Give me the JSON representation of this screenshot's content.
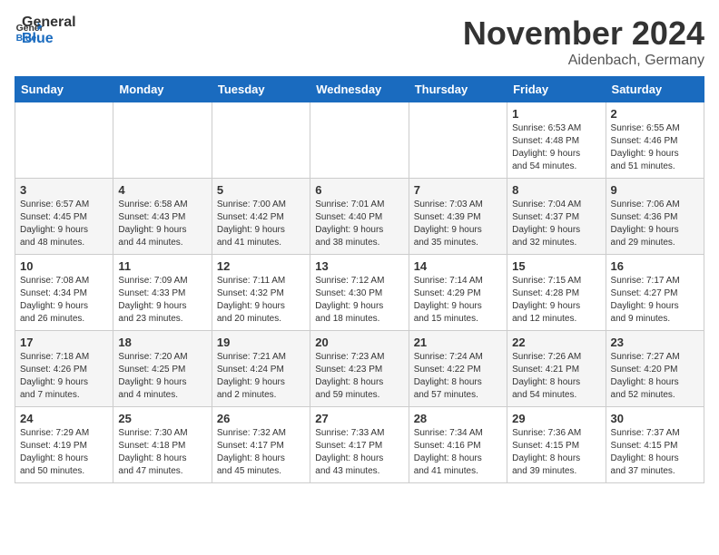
{
  "header": {
    "logo_general": "General",
    "logo_blue": "Blue",
    "month_title": "November 2024",
    "location": "Aidenbach, Germany"
  },
  "days_of_week": [
    "Sunday",
    "Monday",
    "Tuesday",
    "Wednesday",
    "Thursday",
    "Friday",
    "Saturday"
  ],
  "weeks": [
    [
      {
        "day": "",
        "info": ""
      },
      {
        "day": "",
        "info": ""
      },
      {
        "day": "",
        "info": ""
      },
      {
        "day": "",
        "info": ""
      },
      {
        "day": "",
        "info": ""
      },
      {
        "day": "1",
        "info": "Sunrise: 6:53 AM\nSunset: 4:48 PM\nDaylight: 9 hours\nand 54 minutes."
      },
      {
        "day": "2",
        "info": "Sunrise: 6:55 AM\nSunset: 4:46 PM\nDaylight: 9 hours\nand 51 minutes."
      }
    ],
    [
      {
        "day": "3",
        "info": "Sunrise: 6:57 AM\nSunset: 4:45 PM\nDaylight: 9 hours\nand 48 minutes."
      },
      {
        "day": "4",
        "info": "Sunrise: 6:58 AM\nSunset: 4:43 PM\nDaylight: 9 hours\nand 44 minutes."
      },
      {
        "day": "5",
        "info": "Sunrise: 7:00 AM\nSunset: 4:42 PM\nDaylight: 9 hours\nand 41 minutes."
      },
      {
        "day": "6",
        "info": "Sunrise: 7:01 AM\nSunset: 4:40 PM\nDaylight: 9 hours\nand 38 minutes."
      },
      {
        "day": "7",
        "info": "Sunrise: 7:03 AM\nSunset: 4:39 PM\nDaylight: 9 hours\nand 35 minutes."
      },
      {
        "day": "8",
        "info": "Sunrise: 7:04 AM\nSunset: 4:37 PM\nDaylight: 9 hours\nand 32 minutes."
      },
      {
        "day": "9",
        "info": "Sunrise: 7:06 AM\nSunset: 4:36 PM\nDaylight: 9 hours\nand 29 minutes."
      }
    ],
    [
      {
        "day": "10",
        "info": "Sunrise: 7:08 AM\nSunset: 4:34 PM\nDaylight: 9 hours\nand 26 minutes."
      },
      {
        "day": "11",
        "info": "Sunrise: 7:09 AM\nSunset: 4:33 PM\nDaylight: 9 hours\nand 23 minutes."
      },
      {
        "day": "12",
        "info": "Sunrise: 7:11 AM\nSunset: 4:32 PM\nDaylight: 9 hours\nand 20 minutes."
      },
      {
        "day": "13",
        "info": "Sunrise: 7:12 AM\nSunset: 4:30 PM\nDaylight: 9 hours\nand 18 minutes."
      },
      {
        "day": "14",
        "info": "Sunrise: 7:14 AM\nSunset: 4:29 PM\nDaylight: 9 hours\nand 15 minutes."
      },
      {
        "day": "15",
        "info": "Sunrise: 7:15 AM\nSunset: 4:28 PM\nDaylight: 9 hours\nand 12 minutes."
      },
      {
        "day": "16",
        "info": "Sunrise: 7:17 AM\nSunset: 4:27 PM\nDaylight: 9 hours\nand 9 minutes."
      }
    ],
    [
      {
        "day": "17",
        "info": "Sunrise: 7:18 AM\nSunset: 4:26 PM\nDaylight: 9 hours\nand 7 minutes."
      },
      {
        "day": "18",
        "info": "Sunrise: 7:20 AM\nSunset: 4:25 PM\nDaylight: 9 hours\nand 4 minutes."
      },
      {
        "day": "19",
        "info": "Sunrise: 7:21 AM\nSunset: 4:24 PM\nDaylight: 9 hours\nand 2 minutes."
      },
      {
        "day": "20",
        "info": "Sunrise: 7:23 AM\nSunset: 4:23 PM\nDaylight: 8 hours\nand 59 minutes."
      },
      {
        "day": "21",
        "info": "Sunrise: 7:24 AM\nSunset: 4:22 PM\nDaylight: 8 hours\nand 57 minutes."
      },
      {
        "day": "22",
        "info": "Sunrise: 7:26 AM\nSunset: 4:21 PM\nDaylight: 8 hours\nand 54 minutes."
      },
      {
        "day": "23",
        "info": "Sunrise: 7:27 AM\nSunset: 4:20 PM\nDaylight: 8 hours\nand 52 minutes."
      }
    ],
    [
      {
        "day": "24",
        "info": "Sunrise: 7:29 AM\nSunset: 4:19 PM\nDaylight: 8 hours\nand 50 minutes."
      },
      {
        "day": "25",
        "info": "Sunrise: 7:30 AM\nSunset: 4:18 PM\nDaylight: 8 hours\nand 47 minutes."
      },
      {
        "day": "26",
        "info": "Sunrise: 7:32 AM\nSunset: 4:17 PM\nDaylight: 8 hours\nand 45 minutes."
      },
      {
        "day": "27",
        "info": "Sunrise: 7:33 AM\nSunset: 4:17 PM\nDaylight: 8 hours\nand 43 minutes."
      },
      {
        "day": "28",
        "info": "Sunrise: 7:34 AM\nSunset: 4:16 PM\nDaylight: 8 hours\nand 41 minutes."
      },
      {
        "day": "29",
        "info": "Sunrise: 7:36 AM\nSunset: 4:15 PM\nDaylight: 8 hours\nand 39 minutes."
      },
      {
        "day": "30",
        "info": "Sunrise: 7:37 AM\nSunset: 4:15 PM\nDaylight: 8 hours\nand 37 minutes."
      }
    ]
  ]
}
